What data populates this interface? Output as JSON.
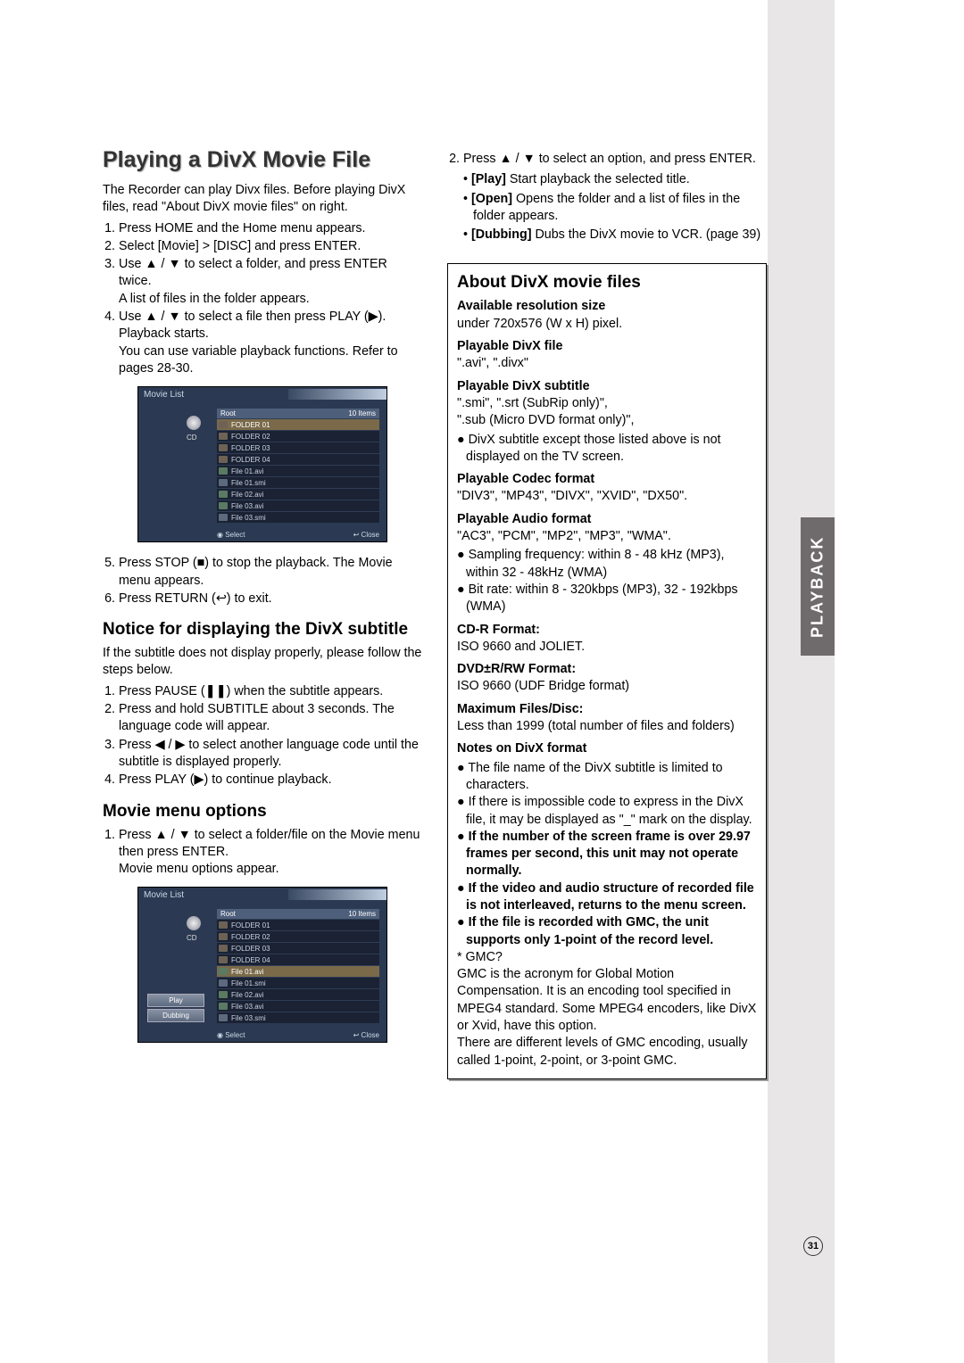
{
  "tab_label": "PLAYBACK",
  "page_number": "31",
  "left": {
    "h1": "Playing a DivX Movie File",
    "intro": "The Recorder can play Divx files. Before playing DivX files, read \"About DivX movie files\" on right.",
    "steps_a": {
      "s1": "Press HOME and the Home menu appears.",
      "s2": "Select [Movie] > [DISC] and press ENTER.",
      "s3": "Use ▲ / ▼ to select a folder, and press ENTER twice.",
      "s3b": "A list of files in the folder appears.",
      "s4": "Use ▲ / ▼ to select a file then press PLAY (▶). Playback starts.",
      "s4b": "You can use variable playback functions. Refer to pages 28-30."
    },
    "steps_b": {
      "s5": "Press STOP (■) to stop the playback. The Movie menu appears.",
      "s6": "Press RETURN (↩) to exit."
    },
    "h2_notice": "Notice for displaying the DivX subtitle",
    "notice_intro": "If the subtitle does not display properly, please follow the steps below.",
    "notice": {
      "n1": "Press PAUSE (❚❚) when the subtitle appears.",
      "n2": "Press and hold SUBTITLE about 3 seconds. The language code will appear.",
      "n3": "Press ◀ / ▶ to select another language code until the subtitle is displayed properly.",
      "n4": "Press PLAY (▶) to continue playback."
    },
    "h2_menu": "Movie menu options",
    "menu_step1": "Press ▲ / ▼ to select a folder/file on the Movie menu then press ENTER.",
    "menu_step1b": "Movie menu options appear."
  },
  "right": {
    "step2": "Press ▲ / ▼ to select an option, and press ENTER.",
    "play_b": "[Play]",
    "play_t": " Start playback the selected title.",
    "open_b": "[Open]",
    "open_t": " Opens the folder and a list of files in the folder appears.",
    "dub_b": "[Dubbing]",
    "dub_t": " Dubs the DivX movie to VCR. (page 39)",
    "box": {
      "h2": "About DivX movie files",
      "res_h": "Available resolution size",
      "res_t": "under 720x576 (W x H) pixel.",
      "file_h": "Playable DivX file",
      "file_t": "\".avi\", \".divx\"",
      "sub_h": "Playable DivX subtitle",
      "sub_t1": "\".smi\", \".srt (SubRip only)\",",
      "sub_t2": "\".sub (Micro DVD format only)\",",
      "sub_b1": "DivX subtitle except those listed above is not displayed on the TV screen.",
      "codec_h": "Playable Codec format",
      "codec_t": "\"DIV3\", \"MP43\", \"DIVX\", \"XVID\", \"DX50\".",
      "audio_h": "Playable Audio format",
      "audio_t": "\"AC3\", \"PCM\", \"MP2\", \"MP3\", \"WMA\".",
      "audio_b1": "Sampling frequency: within 8 - 48 kHz (MP3), within 32 - 48kHz (WMA)",
      "audio_b2": "Bit rate: within 8 - 320kbps (MP3), 32 - 192kbps (WMA)",
      "cdr_h": "CD-R Format:",
      "cdr_t": "ISO 9660 and JOLIET.",
      "dvd_h": "DVD±R/RW Format:",
      "dvd_t": "ISO 9660 (UDF Bridge format)",
      "max_h": "Maximum Files/Disc:",
      "max_t": "Less than 1999 (total number of files and folders)",
      "notes_h": "Notes on DivX format",
      "n1": "The file name of the DivX subtitle is limited to characters.",
      "n2": "If there is impossible code to express in the DivX file, it may be displayed as \"_\" mark on the display.",
      "n3": "If the number of the screen frame is over 29.97 frames per second, this unit may not operate normally.",
      "n4": "If the video and audio structure of recorded file is not interleaved, returns to the menu screen.",
      "n5": "If the file is recorded with GMC, the unit supports only 1-point of the record level.",
      "gmc_q": "* GMC?",
      "gmc_p1": "GMC is the acronym for Global Motion Compensation. It is an encoding tool specified in MPEG4 standard. Some MPEG4 encoders, like DivX or Xvid, have this option.",
      "gmc_p2": "There are different levels of GMC encoding, usually called 1-point, 2-point, or 3-point GMC."
    }
  },
  "shot": {
    "title": "Movie List",
    "cd": "CD",
    "root": "Root",
    "count": "10 Items",
    "rows": [
      "FOLDER 01",
      "FOLDER 02",
      "FOLDER 03",
      "FOLDER 04",
      "File 01.avi",
      "File 01.smi",
      "File 02.avi",
      "File 03.avi",
      "File 03.smi"
    ],
    "select": "◉ Select",
    "close": "↩ Close",
    "menu_play": "Play",
    "menu_dub": "Dubbing"
  }
}
